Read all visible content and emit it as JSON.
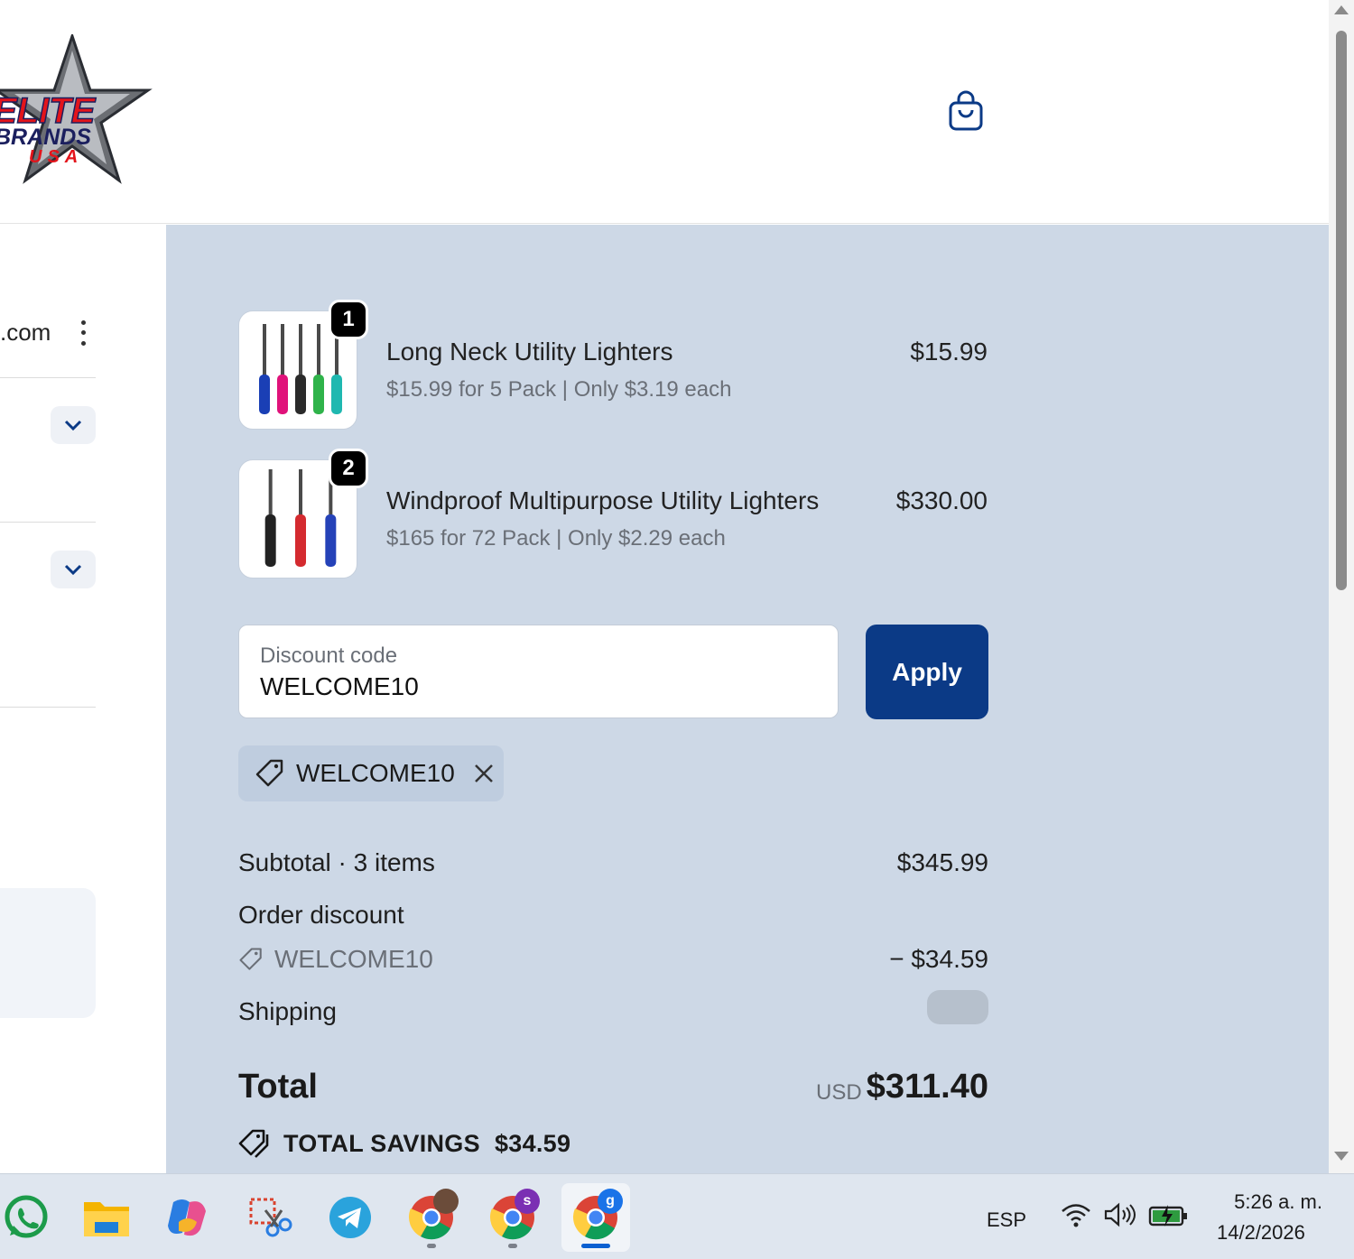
{
  "brand": {
    "line1": "ELITE",
    "line2": "BRANDS",
    "line3": "USA"
  },
  "header": {
    "cart_icon": "shopping-bag-icon"
  },
  "left_column": {
    "email_fragment": ".com",
    "menu_icon": "vertical-ellipsis-icon",
    "expand_icon": "chevron-down-icon"
  },
  "order_summary": {
    "items": [
      {
        "quantity": "1",
        "title": "Long Neck Utility Lighters",
        "subtitle": "$15.99 for 5 Pack | Only $3.19 each",
        "price": "$15.99",
        "colors": [
          "#1a3fb5",
          "#e0127a",
          "#2a2a2a",
          "#2fb34a",
          "#1fb8b0"
        ]
      },
      {
        "quantity": "2",
        "title": "Windproof Multipurpose Utility Lighters",
        "subtitle": "$165 for 72 Pack | Only $2.29 each",
        "price": "$330.00",
        "colors": [
          "#222222",
          "#d42a2f",
          "#2542b8"
        ]
      }
    ],
    "discount": {
      "label": "Discount code",
      "value": "WELCOME10",
      "apply_label": "Apply",
      "applied_code": "WELCOME10"
    },
    "subtotal_label": "Subtotal · 3 items",
    "subtotal_value": "$345.99",
    "order_discount_label": "Order discount",
    "order_discount_code": "WELCOME10",
    "order_discount_value": "− $34.59",
    "shipping_label": "Shipping",
    "total_label": "Total",
    "currency": "USD",
    "total_value": "$311.40",
    "savings_label": "TOTAL SAVINGS",
    "savings_value": "$34.59",
    "accent_color": "#0b3a86",
    "panel_color": "#cdd8e6"
  },
  "taskbar": {
    "apps": [
      {
        "name": "whatsapp-icon"
      },
      {
        "name": "file-explorer-icon"
      },
      {
        "name": "copilot-icon"
      },
      {
        "name": "snipping-tool-icon"
      },
      {
        "name": "telegram-icon"
      },
      {
        "name": "chrome-icon"
      },
      {
        "name": "chrome-icon",
        "badge": "s"
      },
      {
        "name": "chrome-icon",
        "badge": "g"
      }
    ],
    "language": "ESP",
    "time": "5:26 a. m.",
    "date": "14/2/2026"
  }
}
